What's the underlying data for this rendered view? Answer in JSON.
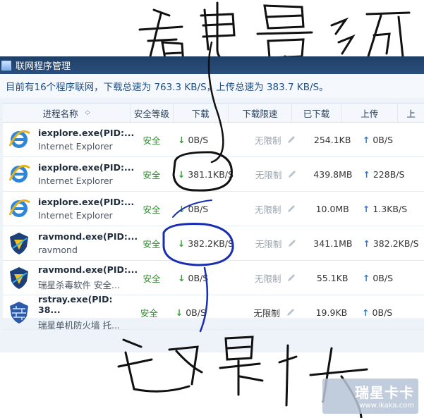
{
  "window": {
    "title": "联网程序管理"
  },
  "summary": "目前有16个程序联网，下载总速为  763.3 KB/S，上传总速为  383.7 KB/S。",
  "columns": [
    "进程名称",
    "安全等级",
    "下载",
    "下载限速",
    "已下载",
    "上传",
    "上"
  ],
  "rows": [
    {
      "name": "iexplore.exe(PID:...",
      "desc": "Internet Explorer",
      "safety": "安全",
      "down": "0B/S",
      "limit": "无限制",
      "downloaded": "254.1KB",
      "up": "0B/S",
      "icon": "ie-icon"
    },
    {
      "name": "iexplore.exe(PID:...",
      "desc": "Internet Explorer",
      "safety": "安全",
      "down": "381.1KB/S",
      "limit": "无限制",
      "downloaded": "439.8MB",
      "up": "228B/S",
      "icon": "ie-icon"
    },
    {
      "name": "iexplore.exe(PID:...",
      "desc": "Internet Explorer",
      "safety": "安全",
      "down": "0B/S",
      "limit": "无限制",
      "downloaded": "10.0MB",
      "up": "1.3KB/S",
      "icon": "ie-icon"
    },
    {
      "name": "ravmond.exe(PID:...",
      "desc": "ravmond",
      "safety": "安全",
      "down": "382.2KB/S",
      "limit": "无限制",
      "downloaded": "341.1MB",
      "up": "382.2KB/S",
      "icon": "rising-shield-icon"
    },
    {
      "name": "ravmond.exe(PID:...",
      "desc": "瑞星杀毒软件  安全...",
      "safety": "安全",
      "down": "0B/S",
      "limit": "无限制",
      "downloaded": "55.1KB",
      "up": "0B/S",
      "icon": "rising-shield-icon"
    },
    {
      "name": "rstray.exe(PID: 38...",
      "desc": "瑞星单机防火墙  托...",
      "safety": "安全",
      "down": "0B/S",
      "limit": "无限制",
      "downloaded": "19.9KB",
      "up": "0B/S",
      "icon": "firewall-icon"
    }
  ],
  "watermark": {
    "brand": "瑞星卡卡",
    "url": "www.ikaka.com"
  }
}
